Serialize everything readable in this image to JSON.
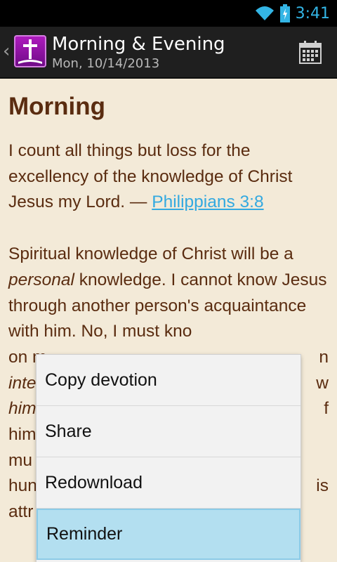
{
  "status_bar": {
    "time": "3:41"
  },
  "action_bar": {
    "title": "Morning & Evening",
    "subtitle": "Mon, 10/14/2013"
  },
  "content": {
    "heading": "Morning",
    "verse_text": "I count all things but loss for the excellency of the knowledge of Christ Jesus my Lord. — ",
    "verse_ref": "Philippians 3:8",
    "p2_a": "Spiritual knowledge of Christ will be a ",
    "p2_b": "personal",
    "p2_c": " knowledge. I cannot know Jesus through another person's acquaintance with him. No, I must kno",
    "p2_d": "on m",
    "p2_e": "inte",
    "p2_f": "him",
    "p2_g": "him",
    "p2_h": "mu",
    "p2_i": "hun",
    "p2_j": "attr",
    "p2_k": "n",
    "p2_l": "w",
    "p2_m": "f",
    "p2_n": "is"
  },
  "menu": {
    "items": [
      "Copy devotion",
      "Share",
      "Redownload",
      "Reminder"
    ]
  },
  "colors": {
    "accent": "#33b5e5",
    "text": "#5a2c10",
    "background": "#f3ead8",
    "link": "#33a9e0"
  }
}
